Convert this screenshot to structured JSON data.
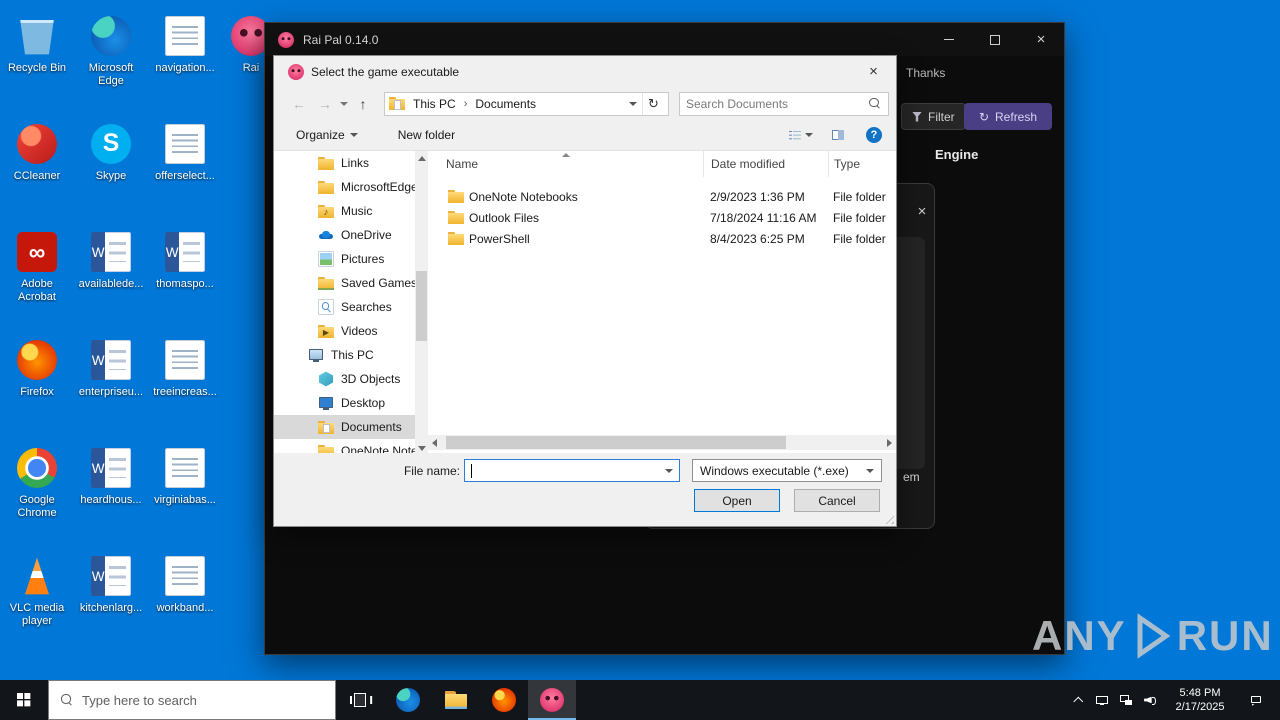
{
  "icons": {
    "close": "×",
    "back": "←",
    "forward": "→",
    "up": "↑",
    "refresh": "↻",
    "crumb_sep": "›"
  },
  "desktop": {
    "col1": [
      {
        "label": "Recycle Bin",
        "icon": "recycle-bin"
      },
      {
        "label": "CCleaner",
        "icon": "ccleaner"
      },
      {
        "label": "Adobe Acrobat",
        "icon": "acrobat"
      },
      {
        "label": "Firefox",
        "icon": "firefox"
      },
      {
        "label": "Google Chrome",
        "icon": "chrome"
      },
      {
        "label": "VLC media player",
        "icon": "vlc"
      }
    ],
    "col2": [
      {
        "label": "Microsoft Edge",
        "icon": "edge"
      },
      {
        "label": "Skype",
        "icon": "skype"
      },
      {
        "label": "availablede...",
        "icon": "word-doc"
      },
      {
        "label": "enterpriseu...",
        "icon": "word-doc"
      },
      {
        "label": "heardhous...",
        "icon": "word-doc"
      },
      {
        "label": "kitchenlarg...",
        "icon": "word-doc"
      }
    ],
    "col3": [
      {
        "label": "navigation...",
        "icon": "text-doc"
      },
      {
        "label": "offerselect...",
        "icon": "text-doc"
      },
      {
        "label": "thomaspo...",
        "icon": "word-doc"
      },
      {
        "label": "treeincreas...",
        "icon": "text-doc"
      },
      {
        "label": "virginiabas...",
        "icon": "text-doc"
      },
      {
        "label": "workband...",
        "icon": "text-doc"
      }
    ],
    "col4": [
      {
        "label": "Rai",
        "icon": "rai-pal"
      }
    ]
  },
  "raipal": {
    "title": "Rai Pal 0.14.0",
    "nav_thanks": "Thanks",
    "filter_label": "Filter",
    "refresh_label": "Refresh",
    "engine_header": "Engine",
    "clipped_text": "em",
    "accent_purple": "#4a3e85"
  },
  "dialog": {
    "title": "Select the game executable",
    "nav": {
      "path_root": "This PC",
      "path_current": "Documents",
      "search_placeholder": "Search Documents"
    },
    "toolbar": {
      "organize": "Organize",
      "new_folder": "New folder"
    },
    "sidebar": [
      {
        "label": "Links",
        "icon": "folder"
      },
      {
        "label": "MicrosoftEdgeB",
        "icon": "folder"
      },
      {
        "label": "Music",
        "icon": "music"
      },
      {
        "label": "OneDrive",
        "icon": "onedrive"
      },
      {
        "label": "Pictures",
        "icon": "pictures"
      },
      {
        "label": "Saved Games",
        "icon": "saved-games"
      },
      {
        "label": "Searches",
        "icon": "searches"
      },
      {
        "label": "Videos",
        "icon": "videos"
      },
      {
        "label": "This PC",
        "icon": "this-pc",
        "cls": "lvl0"
      },
      {
        "label": "3D Objects",
        "icon": "3d-objects"
      },
      {
        "label": "Desktop",
        "icon": "desktop"
      },
      {
        "label": "Documents",
        "icon": "documents",
        "cls": "selected"
      },
      {
        "label": "OneNote Notebooks",
        "icon": "folder"
      }
    ],
    "list": {
      "columns": [
        "Name",
        "Date modified",
        "Type"
      ],
      "rows": [
        {
          "name": "OneNote Notebooks",
          "date": "2/9/2023 1:36 PM",
          "type": "File folder",
          "icon": "folder"
        },
        {
          "name": "Outlook Files",
          "date": "7/18/2024 11:16 AM",
          "type": "File folder",
          "icon": "folder"
        },
        {
          "name": "PowerShell",
          "date": "8/4/2023 6:25 PM",
          "type": "File folder",
          "icon": "folder"
        }
      ]
    },
    "footer": {
      "file_name_label": "File name:",
      "file_name_value": "",
      "file_type_value": "Windows executable (*.exe)",
      "open_label": "Open",
      "cancel_label": "Cancel"
    }
  },
  "taskbar": {
    "search_placeholder": "Type here to search",
    "apps": [
      {
        "icon": "task-view"
      },
      {
        "icon": "edge"
      },
      {
        "icon": "file-explorer"
      },
      {
        "icon": "firefox"
      },
      {
        "icon": "rai-pal",
        "cls": "active"
      }
    ],
    "clock": {
      "time": "5:48 PM",
      "date": "2/17/2025"
    }
  },
  "watermark": {
    "left": "ANY",
    "right": "RUN"
  }
}
